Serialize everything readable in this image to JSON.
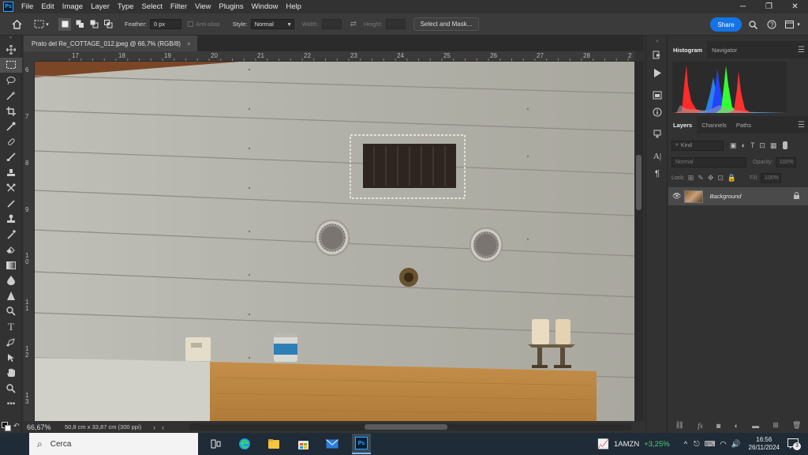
{
  "app": {
    "logo": "Ps"
  },
  "menu": [
    "File",
    "Edit",
    "Image",
    "Layer",
    "Type",
    "Select",
    "Filter",
    "View",
    "Plugins",
    "Window",
    "Help"
  ],
  "window_controls": [
    "─",
    "❐",
    "✕"
  ],
  "options": {
    "feather_label": "Feather:",
    "feather_value": "0 px",
    "antialias_label": "Anti-alias",
    "style_label": "Style:",
    "style_value": "Normal",
    "width_label": "Width:",
    "height_label": "Height:",
    "select_mask": "Select and Mask...",
    "share": "Share"
  },
  "document": {
    "tab_title": "Prato del Re_COTTAGE_012.jpeg @ 66,7% (RGB/8)",
    "close": "×",
    "zoom": "66,67%",
    "size": "50,8 cm x 33,87 cm (300 ppi)"
  },
  "rulers": {
    "top": [
      "17",
      "18",
      "19",
      "20",
      "21",
      "22",
      "23",
      "24",
      "25",
      "26",
      "27",
      "28",
      "2"
    ],
    "left": [
      "6",
      "7",
      "8",
      "9",
      "1\n0",
      "1\n1",
      "1\n2",
      "1\n3"
    ]
  },
  "panels": {
    "top_tabs": [
      "Histogram",
      "Navigator"
    ],
    "layer_tabs": [
      "Layers",
      "Channels",
      "Paths"
    ],
    "kind": "Kind",
    "blend": "Normal",
    "opacity_label": "Opacity:",
    "opacity_value": "100%",
    "lock_label": "Lock:",
    "fill_label": "Fill:",
    "fill_value": "100%",
    "layer_name": "Background"
  },
  "taskbar": {
    "search": "Cerca",
    "ticker": "1AMZN",
    "change": "+3,25%",
    "time": "16:56",
    "date": "26/11/2024",
    "badge": "3"
  },
  "histogram": {
    "channels": [
      "red",
      "green",
      "blue",
      "gray"
    ]
  },
  "colors": {
    "share": "#1473e6",
    "positive": "#49d27b",
    "selection": "#ffffff"
  }
}
